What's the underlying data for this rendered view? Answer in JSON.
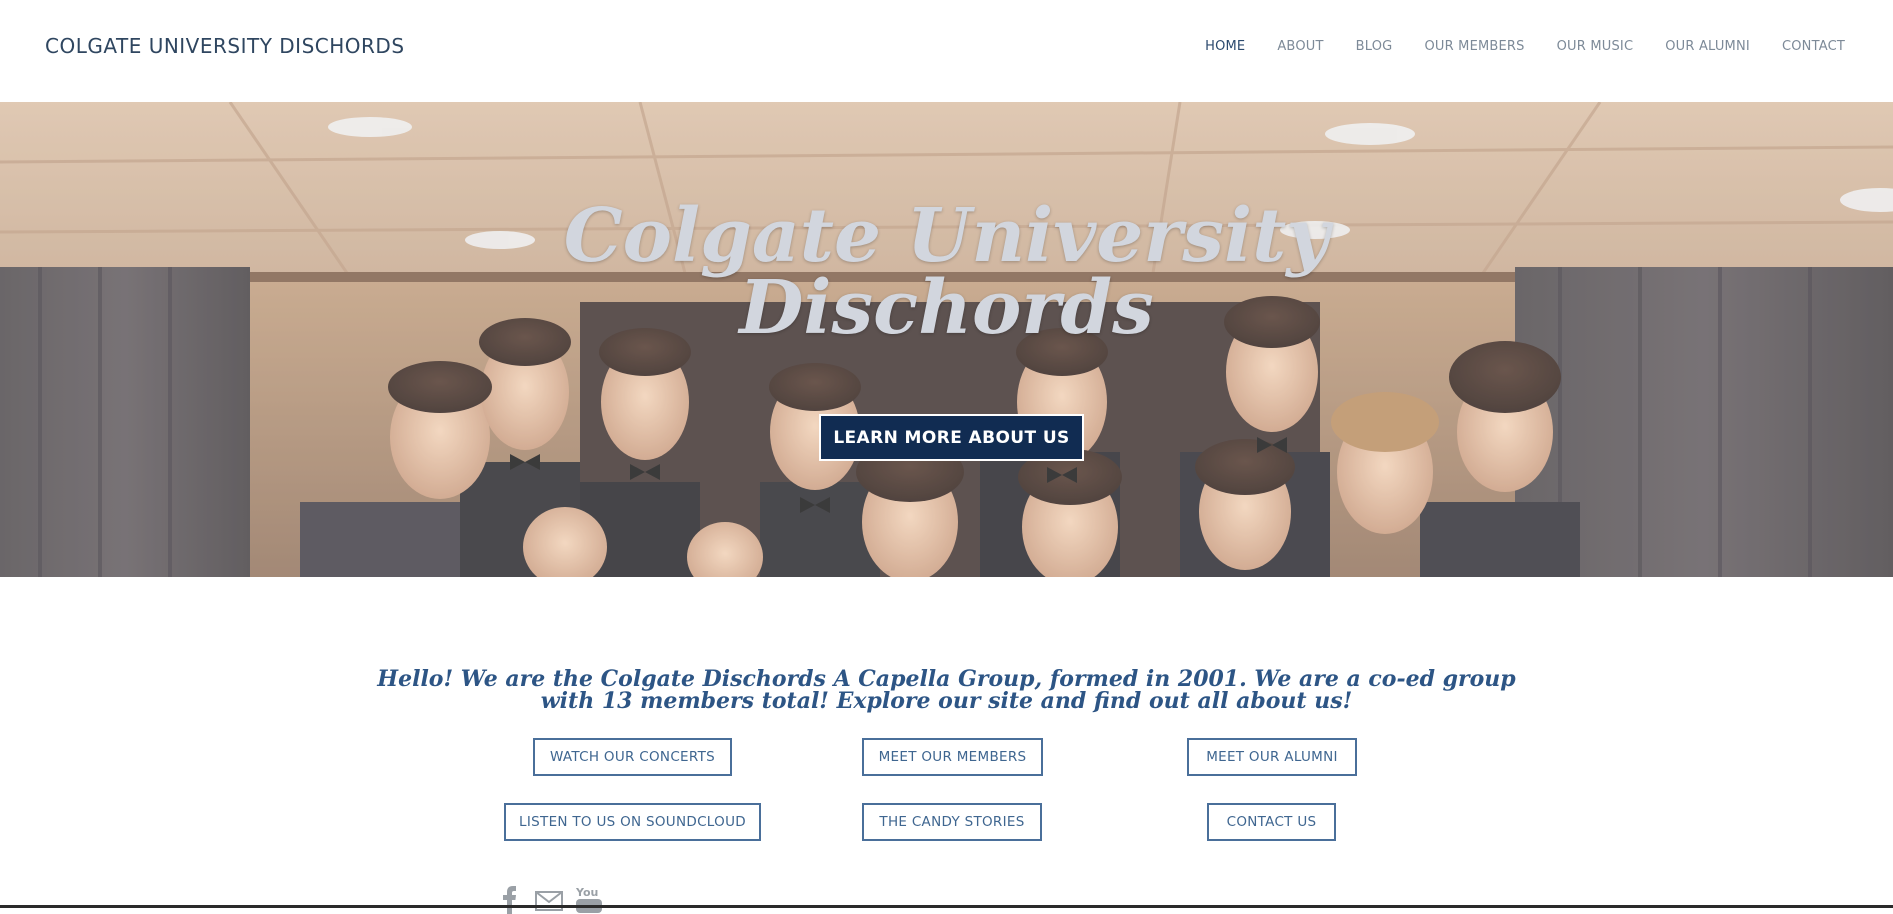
{
  "header": {
    "site_title": "COLGATE UNIVERSITY DISCHORDS",
    "nav": [
      {
        "label": "HOME",
        "active": true
      },
      {
        "label": "ABOUT",
        "active": false
      },
      {
        "label": "BLOG",
        "active": false
      },
      {
        "label": "OUR MEMBERS",
        "active": false
      },
      {
        "label": "OUR MUSIC",
        "active": false
      },
      {
        "label": "OUR ALUMNI",
        "active": false
      },
      {
        "label": "CONTACT",
        "active": false
      }
    ]
  },
  "hero": {
    "title_line1": "Colgate University",
    "title_line2": "Dischords",
    "button_label": "LEARN MORE ABOUT US"
  },
  "intro": {
    "line1": "Hello! We are the Colgate Dischords A Capella Group, formed in 2001.  We are a co-ed group",
    "line2": "with 13 members total!  Explore our site and find out all about us!"
  },
  "links": {
    "watch_concerts": "WATCH OUR CONCERTS",
    "meet_members": "MEET OUR MEMBERS",
    "meet_alumni": "MEET OUR ALUMNI",
    "soundcloud": "LISTEN TO US ON SOUNDCLOUD",
    "candy_stories": "THE CANDY STORIES",
    "contact_us": "CONTACT US"
  },
  "social": {
    "icons": [
      "facebook-icon",
      "mail-icon",
      "youtube-icon"
    ],
    "youtube_text": "You"
  },
  "colors": {
    "accent": "#112c52",
    "link": "#3f6690",
    "title": "#2f4660"
  }
}
